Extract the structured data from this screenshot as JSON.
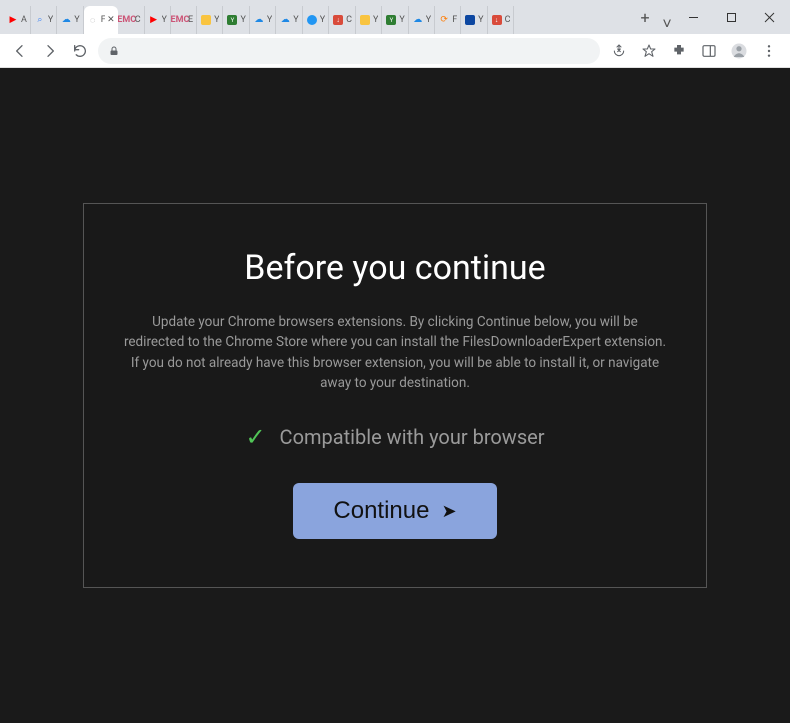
{
  "window": {
    "controls": {
      "min": "—",
      "max": "☐",
      "close": "✕"
    },
    "chevron": "˅"
  },
  "tabs": [
    {
      "icon": "youtube-icon",
      "label": "A"
    },
    {
      "icon": "search-icon",
      "label": "Y"
    },
    {
      "icon": "cloud-icon",
      "label": "Y"
    },
    {
      "icon": "generic-icon",
      "label": "Fi",
      "active": true
    },
    {
      "icon": "emc-icon",
      "label": "C"
    },
    {
      "icon": "youtube-icon",
      "label": "Y"
    },
    {
      "icon": "emc-icon",
      "label": "E"
    },
    {
      "icon": "yellow-icon",
      "label": "Y"
    },
    {
      "icon": "green-icon",
      "label": "Y"
    },
    {
      "icon": "cloud-icon",
      "label": "Y"
    },
    {
      "icon": "cloud-icon",
      "label": "Y"
    },
    {
      "icon": "blue-dot-icon",
      "label": "Y"
    },
    {
      "icon": "download-icon",
      "label": "C"
    },
    {
      "icon": "yellow-icon",
      "label": "Y"
    },
    {
      "icon": "green-icon",
      "label": "Y"
    },
    {
      "icon": "cloud-icon",
      "label": "Y"
    },
    {
      "icon": "cloudflare-icon",
      "label": "F"
    },
    {
      "icon": "ytplayer-icon",
      "label": "Y"
    },
    {
      "icon": "download-icon",
      "label": "C"
    }
  ],
  "newtab": "+",
  "toolbar": {
    "back": "back",
    "forward": "forward",
    "reload": "reload",
    "lock": "lock-icon",
    "share": "share-icon",
    "star": "star-icon",
    "ext": "extensions-icon",
    "panel": "panel-icon",
    "profile": "profile-icon",
    "menu": "menu-icon"
  },
  "dialog": {
    "title": "Before you continue",
    "body": "Update your Chrome browsers extensions. By clicking Continue below, you will be redirected to the Chrome Store where you can install the FilesDownloaderExpert extension. If you do not already have this browser extension, you will be able to install it, or navigate away to your destination.",
    "compatible": "Compatible with your browser",
    "button": "Continue",
    "arrow": "➤"
  }
}
